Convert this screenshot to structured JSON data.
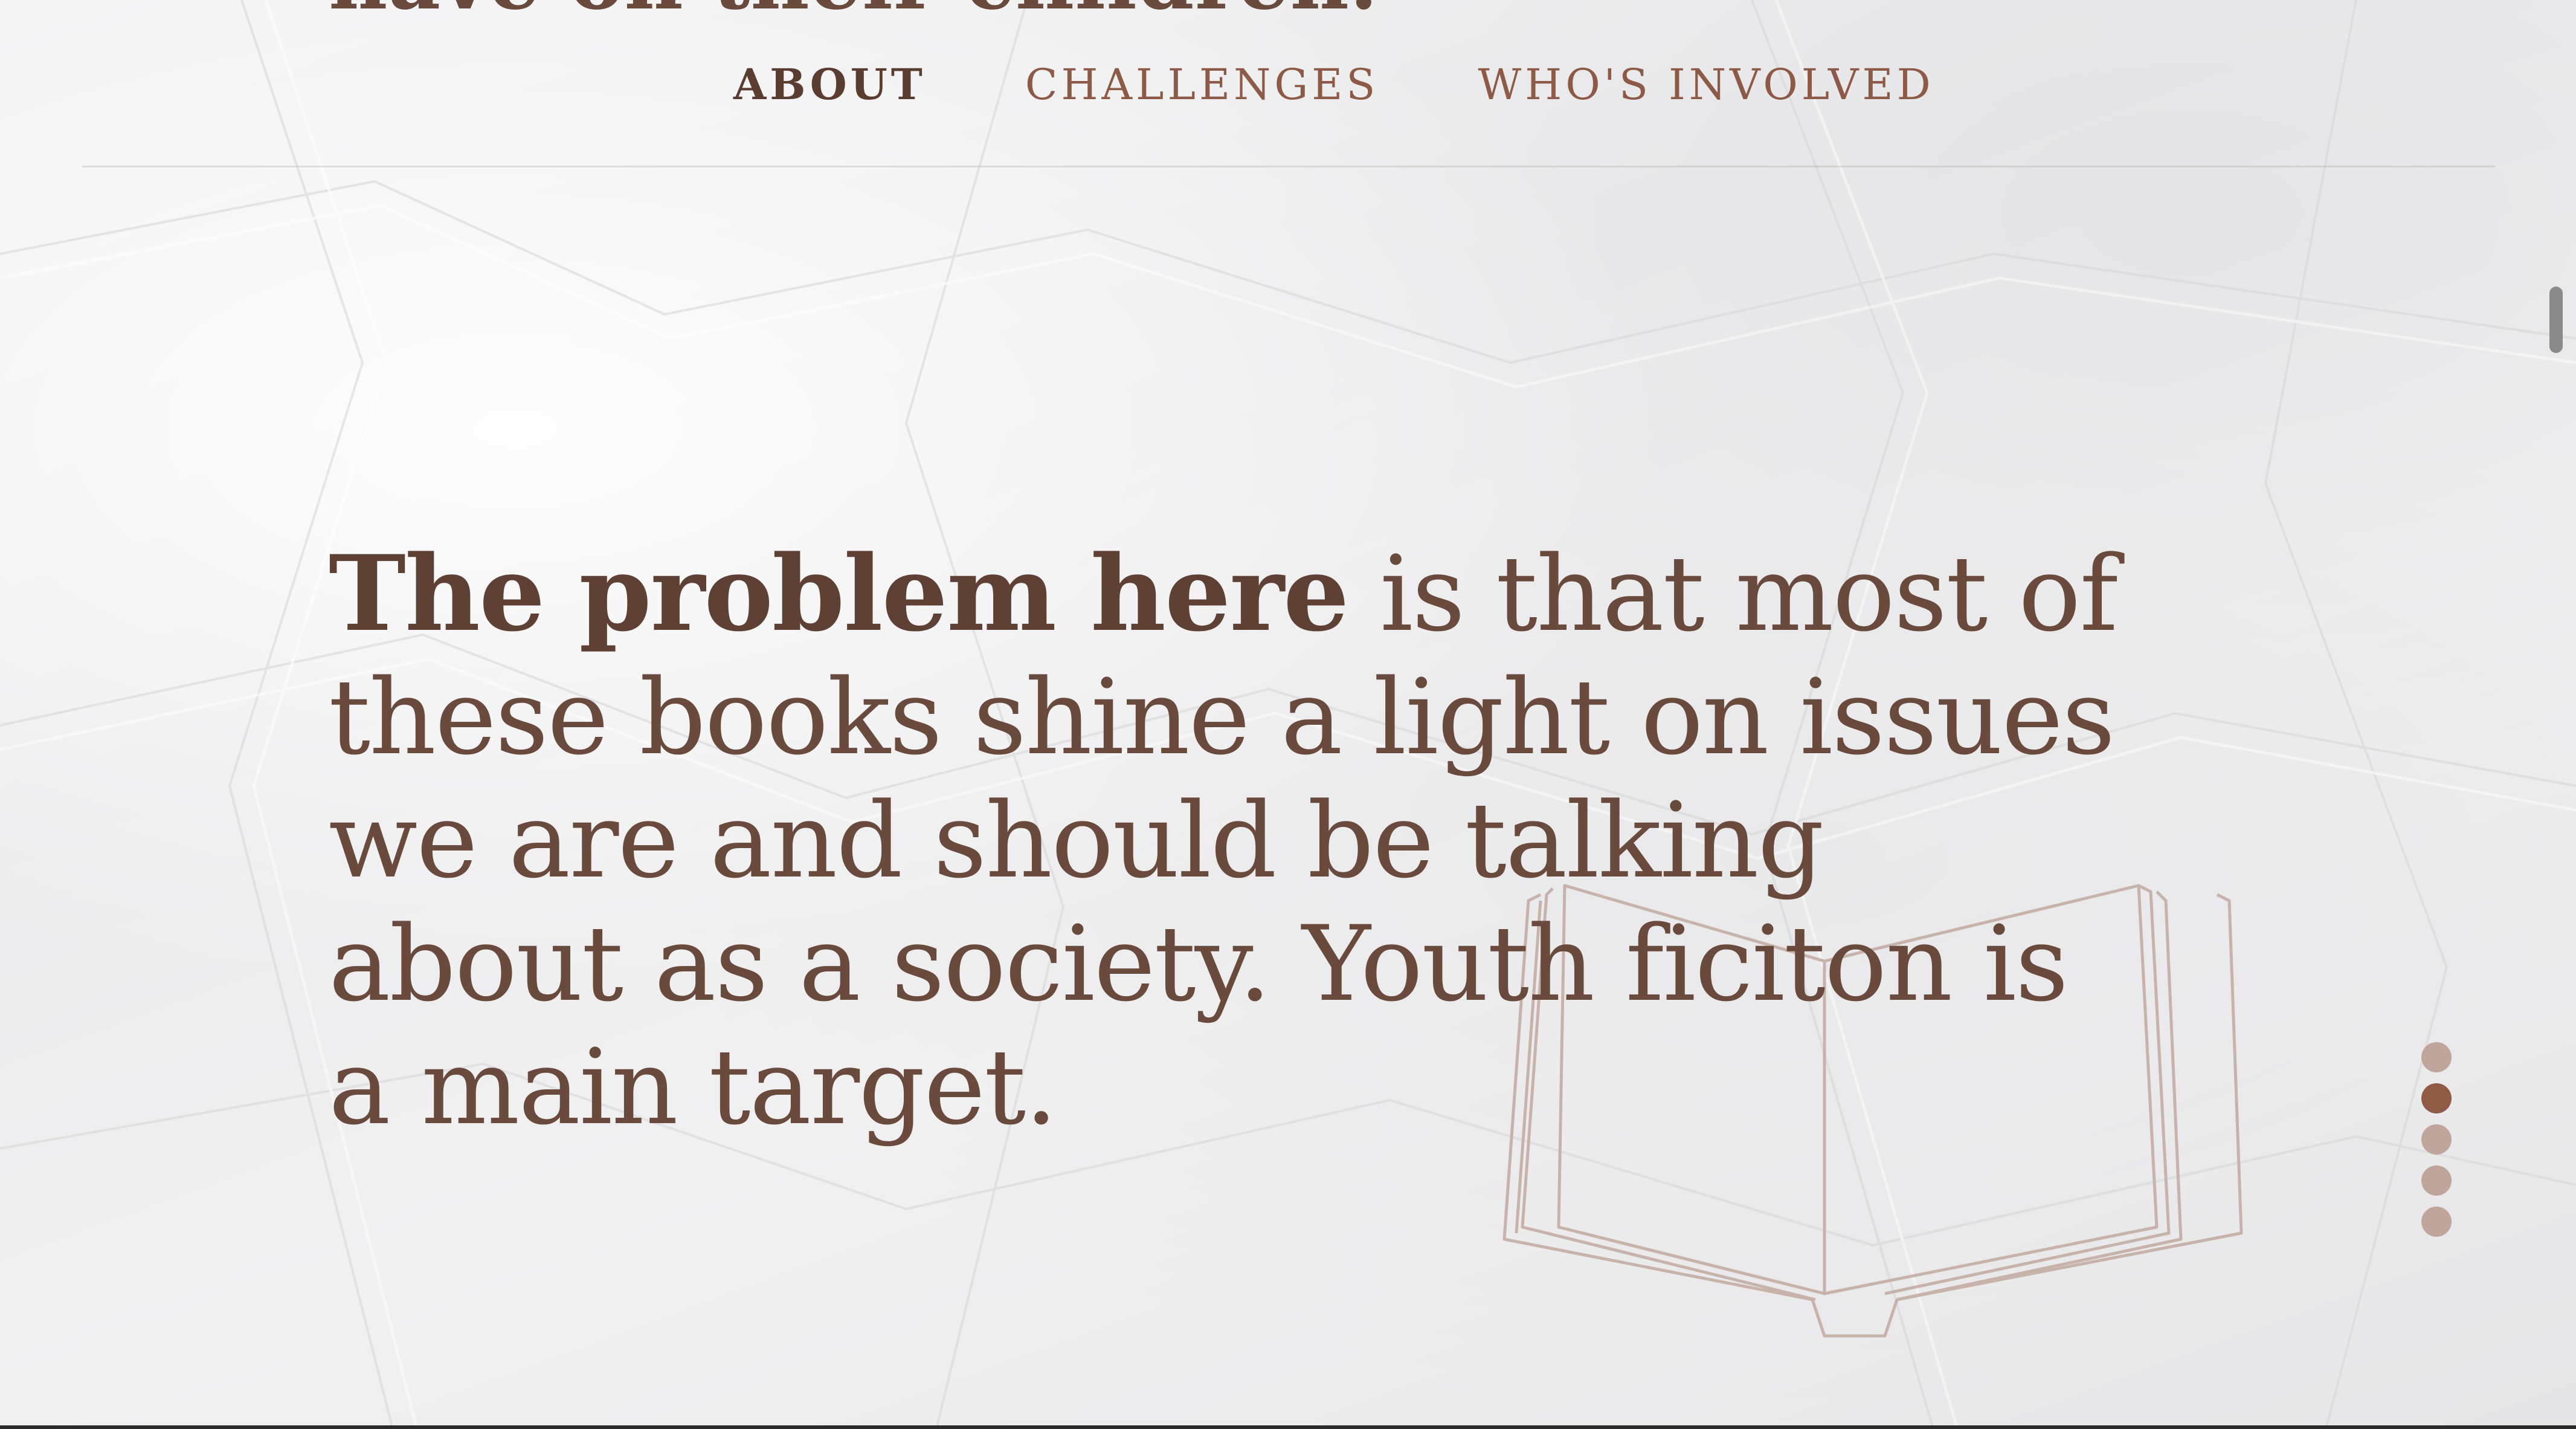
{
  "header": {
    "heading_fragment": "have on their children."
  },
  "nav": {
    "items": [
      {
        "label": "ABOUT",
        "active": true
      },
      {
        "label": "CHALLENGES",
        "active": false
      },
      {
        "label": "WHO'S INVOLVED",
        "active": false
      }
    ]
  },
  "main": {
    "lead_bold": "The problem here",
    "body": " is that most of these books shine a light on issues we are and should be talking about as a society. Youth ficiton is a main target."
  },
  "section_dots": {
    "count": 5,
    "active_index": 1
  },
  "colors": {
    "text_primary": "#6b4a3e",
    "nav_link": "#8c5a46",
    "nav_active": "#5a3c30",
    "dot_inactive": "#bfa59b",
    "dot_active": "#8f5a46",
    "book_outline": "#c8b3ab"
  },
  "icons": {
    "illustration": "open-book-icon"
  }
}
